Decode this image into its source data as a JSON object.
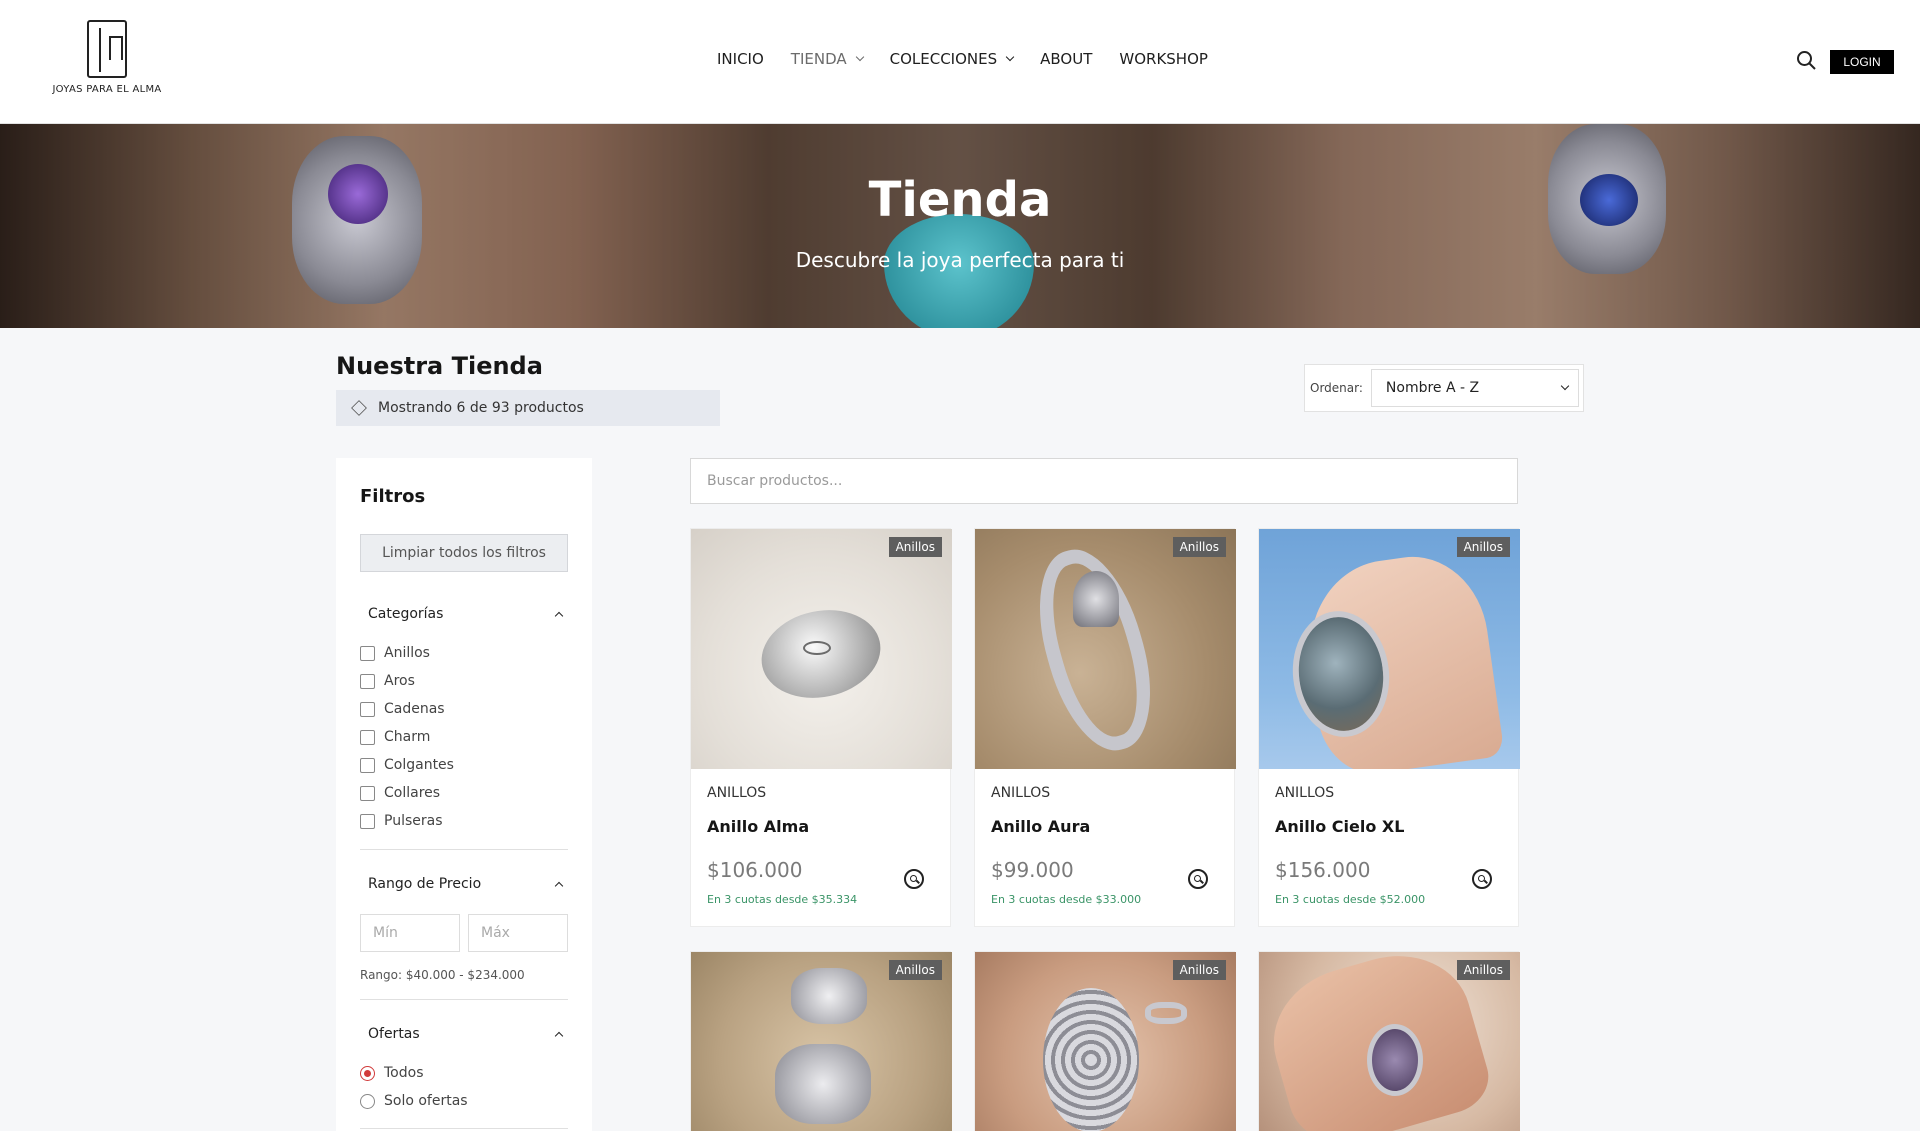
{
  "header": {
    "logo_text": "JOYAS PARA EL ALMA",
    "nav": [
      {
        "label": "INICIO",
        "dropdown": false,
        "active": false
      },
      {
        "label": "TIENDA",
        "dropdown": true,
        "active": true
      },
      {
        "label": "COLECCIONES",
        "dropdown": true,
        "active": false
      },
      {
        "label": "ABOUT",
        "dropdown": false,
        "active": false
      },
      {
        "label": "WORKSHOP",
        "dropdown": false,
        "active": false
      }
    ],
    "search_icon": "search-icon",
    "login_label": "LOGIN"
  },
  "hero": {
    "title": "Tienda",
    "subtitle": "Descubre la joya perfecta para ti"
  },
  "shop": {
    "title": "Nuestra Tienda",
    "count_text": "Mostrando 6 de 93 productos",
    "count_icon": "box-icon",
    "sort_label": "Ordenar:",
    "sort_value": "Nombre A - Z"
  },
  "filters": {
    "title": "Filtros",
    "clear_label": "Limpiar todos los filtros",
    "categories_title": "Categorías",
    "categories": [
      "Anillos",
      "Aros",
      "Cadenas",
      "Charm",
      "Colgantes",
      "Collares",
      "Pulseras"
    ],
    "price_title": "Rango de Precio",
    "price_min_placeholder": "Mín",
    "price_max_placeholder": "Máx",
    "price_range_note": "Rango: $40.000 - $234.000",
    "offers_title": "Ofertas",
    "offers_options": [
      {
        "label": "Todos",
        "selected": true
      },
      {
        "label": "Solo ofertas",
        "selected": false
      }
    ]
  },
  "search": {
    "placeholder": "Buscar productos..."
  },
  "products": [
    {
      "badge": "Anillos",
      "category": "ANILLOS",
      "name": "Anillo Alma",
      "price": "$106.000",
      "installments": "En 3 cuotas desde $35.334"
    },
    {
      "badge": "Anillos",
      "category": "ANILLOS",
      "name": "Anillo Aura",
      "price": "$99.000",
      "installments": "En 3 cuotas desde $33.000"
    },
    {
      "badge": "Anillos",
      "category": "ANILLOS",
      "name": "Anillo Cielo XL",
      "price": "$156.000",
      "installments": "En 3 cuotas desde $52.000"
    },
    {
      "badge": "Anillos"
    },
    {
      "badge": "Anillos"
    },
    {
      "badge": "Anillos"
    }
  ],
  "colors": {
    "accent_black": "#000000",
    "installments_green": "#3a9467",
    "radio_selected": "#d13b3b",
    "badge_gray": "#5e5e5e"
  }
}
